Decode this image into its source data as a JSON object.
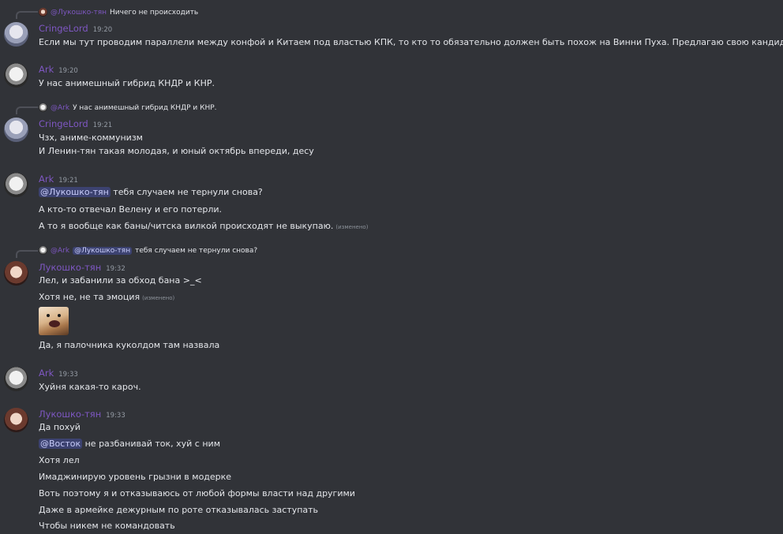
{
  "colors": {
    "background": "#313338",
    "username": "#7e57c2",
    "mention_bg": "#3c4270",
    "text": "#e4e6ea",
    "timestamp": "#949ba4"
  },
  "messages": [
    {
      "reply": {
        "author": "@Лукошко-тян",
        "text": "Ничего не происходить"
      },
      "author": "CringeLord",
      "time": "19:20",
      "lines": [
        "Если мы тут проводим параллели между конфой и Китаем под властью КПК, то кто то обязательно должен быть похож на Винни Пуха. Предлагаю свою кандидатуру"
      ]
    },
    {
      "author": "Ark",
      "time": "19:20",
      "lines": [
        "У нас анимешный гибрид КНДР и КНР."
      ]
    },
    {
      "reply": {
        "author": "@Ark",
        "text": "У нас анимешный гибрид КНДР и КНР."
      },
      "author": "CringeLord",
      "time": "19:21",
      "lines": [
        "Чзх, аниме-коммунизм",
        "И Ленин-тян такая молодая, и юный октябрь впереди, десу"
      ]
    },
    {
      "author": "Ark",
      "time": "19:21",
      "mention": "@Лукошко-тян",
      "lines": [
        "тебя случаем не тернули снова?",
        "А кто-то отвечал Велену и его потерли.",
        "А то я вообще как баны/читска вилкой происходят не выкупаю."
      ],
      "edited": "(изменено)"
    },
    {
      "reply": {
        "author": "@Ark",
        "mention": "@Лукошко-тян",
        "text": "тебя случаем не тернули снова?"
      },
      "author": "Лукошко-тян",
      "time": "19:32",
      "lines": [
        "Лел, и забанили за обход бана >_<",
        "Хотя не, не та эмоция",
        "Да, я палочника куколдом там назвала"
      ],
      "edited": "(изменено)"
    },
    {
      "author": "Ark",
      "time": "19:33",
      "lines": [
        "Хуйня какая-то кароч."
      ]
    },
    {
      "author": "Лукошко-тян",
      "time": "19:33",
      "mention": "@Восток",
      "lines": [
        "Да похуй",
        "не разбанивай ток, хуй с ним",
        "Хотя лел",
        "Имаджинирую уровень грызни в модерке",
        "Воть поэтому я и отказываюсь от любой формы власти над другими",
        "Даже в армейке дежурным по роте отказывалась заступать",
        "Чтобы никем не командовать"
      ]
    }
  ]
}
